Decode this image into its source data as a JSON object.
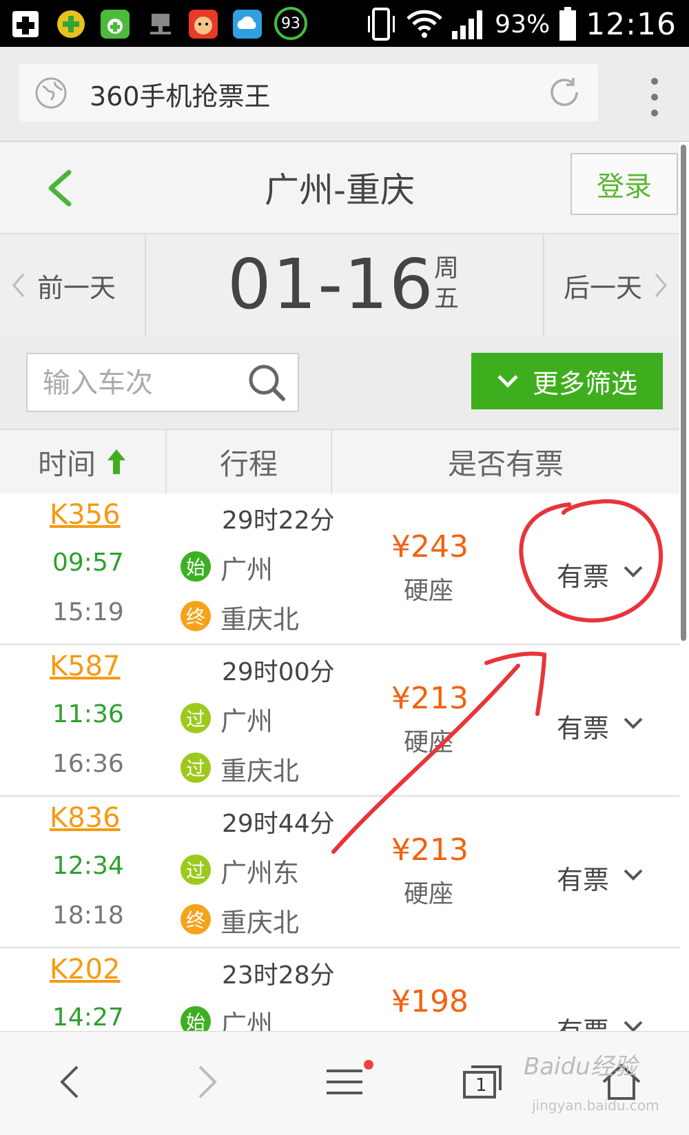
{
  "statusbar": {
    "battery": "93%",
    "time": "12:16",
    "badge_number": "93"
  },
  "browser": {
    "url_title": "360手机抢票王"
  },
  "header": {
    "title": "广州-重庆",
    "login": "登录"
  },
  "datebar": {
    "prev": "前一天",
    "date": "01-16",
    "weekday_1": "周",
    "weekday_2": "五",
    "next": "后一天"
  },
  "filter": {
    "search_placeholder": "输入车次",
    "more": "更多筛选"
  },
  "columns": {
    "time": "时间",
    "route": "行程",
    "availability": "是否有票"
  },
  "trains": [
    {
      "no": "K356",
      "duration": "29时22分",
      "dep": "09:57",
      "arr": "15:19",
      "from_badge": "始",
      "from": "广州",
      "to_badge": "终",
      "to": "重庆北",
      "price": "¥243",
      "seat": "硬座",
      "avail": "有票"
    },
    {
      "no": "K587",
      "duration": "29时00分",
      "dep": "11:36",
      "arr": "16:36",
      "from_badge": "过",
      "from": "广州",
      "to_badge": "过",
      "to": "重庆北",
      "price": "¥213",
      "seat": "硬座",
      "avail": "有票"
    },
    {
      "no": "K836",
      "duration": "29时44分",
      "dep": "12:34",
      "arr": "18:18",
      "from_badge": "过",
      "from": "广州东",
      "to_badge": "终",
      "to": "重庆北",
      "price": "¥213",
      "seat": "硬座",
      "avail": "有票"
    },
    {
      "no": "K202",
      "duration": "23时28分",
      "dep": "14:27",
      "arr": "",
      "from_badge": "始",
      "from": "广州",
      "to_badge": "",
      "to": "",
      "price": "¥198",
      "seat": "",
      "avail": "有票"
    }
  ],
  "bottombar": {
    "tab_count": "1"
  },
  "watermark": {
    "line1": "Baidu经验",
    "line2": "jingyan.baidu.com"
  },
  "colors": {
    "green": "#3fae1e",
    "orange": "#f59a13",
    "price": "#f2620f",
    "badge_start": "#3cb022",
    "badge_pass": "#9cc91c",
    "badge_end": "#f5a31a",
    "annotation": "#e8343a"
  }
}
